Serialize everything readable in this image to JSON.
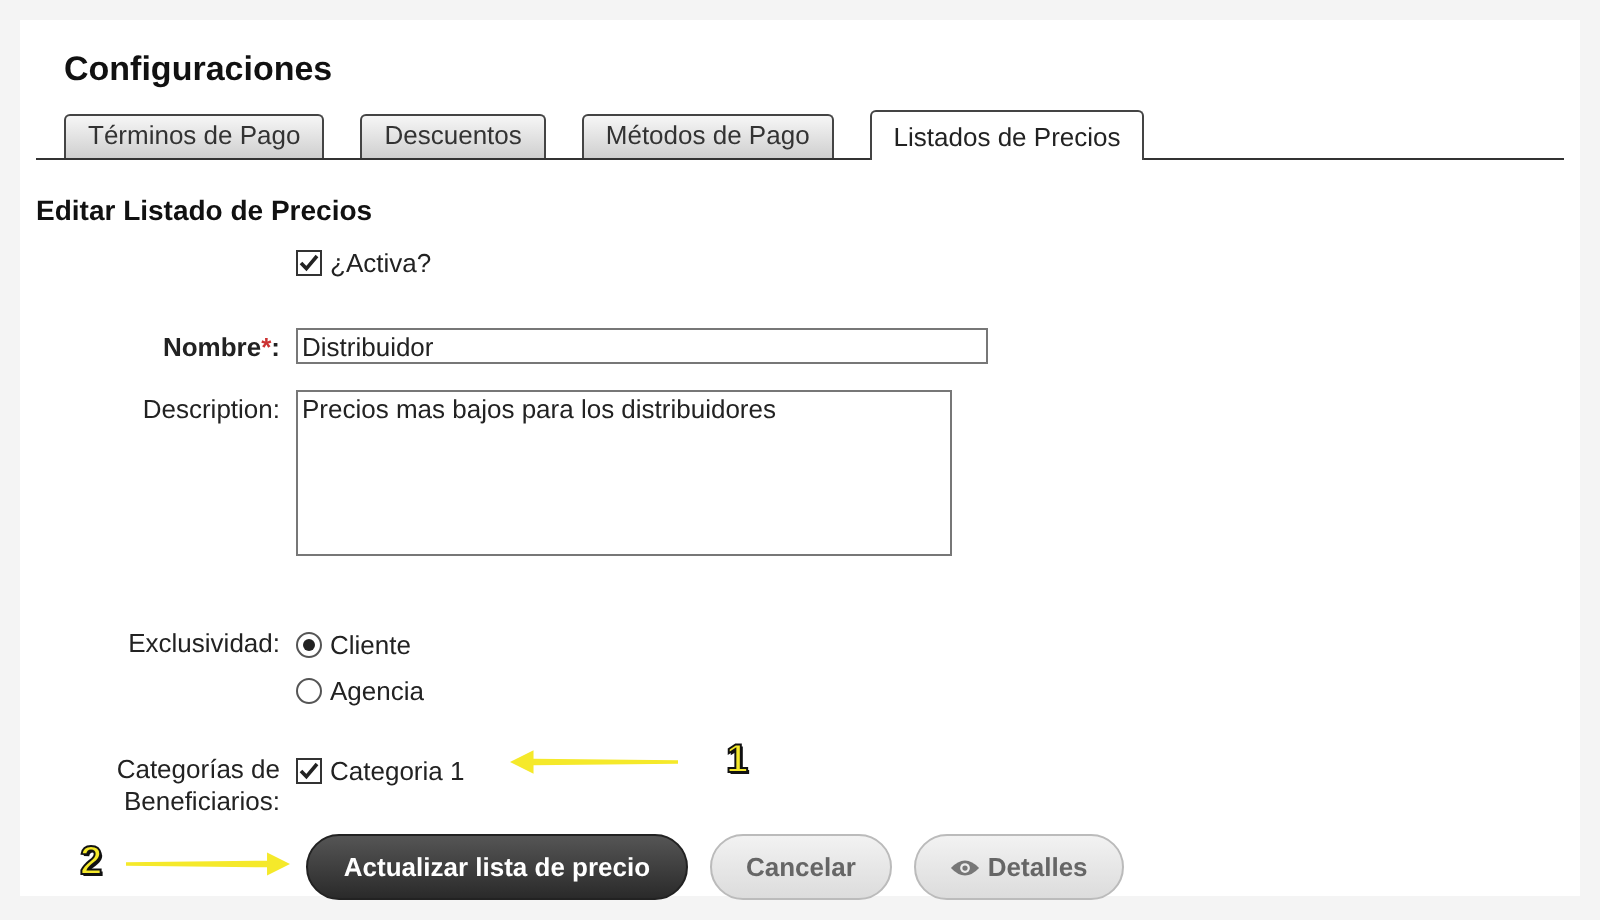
{
  "title": "Configuraciones",
  "tabs": [
    {
      "label": "Términos de Pago",
      "selected": false
    },
    {
      "label": "Descuentos",
      "selected": false
    },
    {
      "label": "Métodos de Pago",
      "selected": false
    },
    {
      "label": "Listados de Precios",
      "selected": true
    }
  ],
  "section_title": "Editar Listado de Precios",
  "active": {
    "label": "¿Activa?",
    "checked": true
  },
  "name": {
    "label": "Nombre",
    "required_mark": "*",
    "colon": ":",
    "value": "Distribuidor"
  },
  "description": {
    "label": "Description:",
    "value": "Precios mas bajos para los distribuidores"
  },
  "exclusivity": {
    "label": "Exclusividad:",
    "options": [
      {
        "label": "Cliente",
        "selected": true
      },
      {
        "label": "Agencia",
        "selected": false
      }
    ]
  },
  "categories": {
    "label": "Categorías de Beneficiarios:",
    "items": [
      {
        "label": "Categoria 1",
        "checked": true
      }
    ]
  },
  "buttons": [
    {
      "label": "Actualizar lista de precio",
      "kind": "primary"
    },
    {
      "label": "Cancelar",
      "kind": "secondary"
    },
    {
      "label": "Detalles",
      "kind": "details"
    }
  ],
  "annotations": [
    {
      "number": "1",
      "kind": "left"
    },
    {
      "number": "2",
      "kind": "right"
    }
  ]
}
